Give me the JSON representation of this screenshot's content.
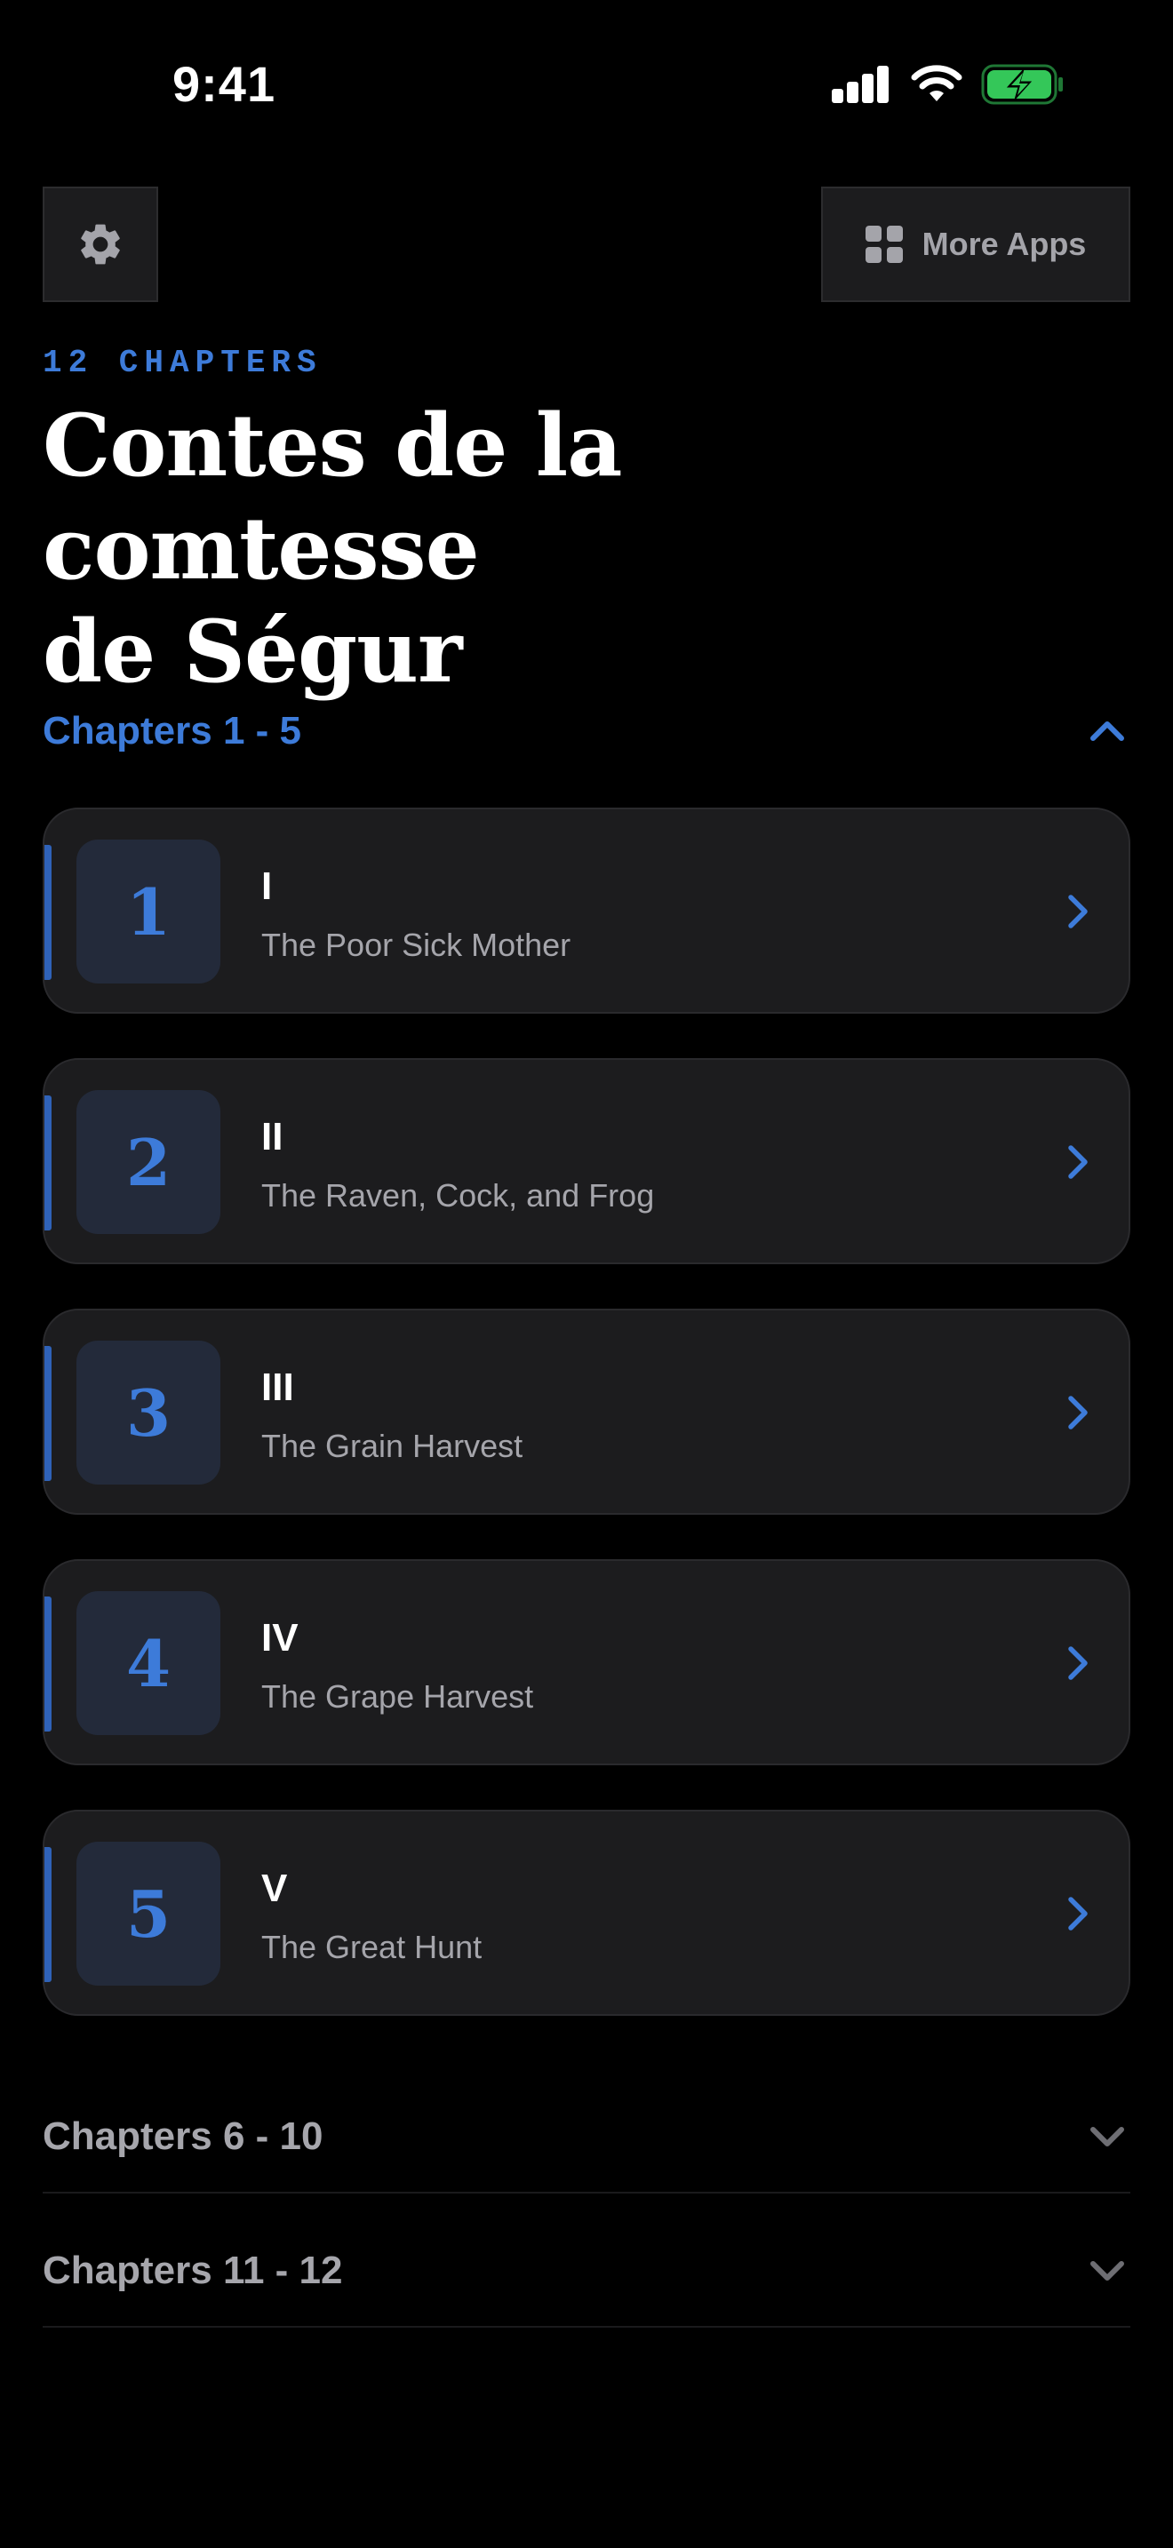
{
  "status_bar": {
    "time": "9:41",
    "signal_icon": "cellular-signal-icon",
    "wifi_icon": "wifi-icon",
    "battery_icon": "battery-charging-icon",
    "battery_color": "#34c759"
  },
  "toolbar": {
    "settings_icon": "gear-icon",
    "more_apps_icon": "grid-icon",
    "more_apps_label": "More Apps"
  },
  "header": {
    "chapter_count": "12 CHAPTERS",
    "title_line1": "Contes de la comtesse",
    "title_line2": "de Ségur"
  },
  "colors": {
    "accent": "#3d7bd9",
    "background": "#000000",
    "card": "#1c1c1e"
  },
  "sections": [
    {
      "label": "Chapters 1 - 5",
      "expanded": true,
      "icon": "chevron-up-icon",
      "chapters": [
        {
          "number": "1",
          "roman": "I",
          "title": "The Poor Sick Mother"
        },
        {
          "number": "2",
          "roman": "II",
          "title": "The Raven, Cock, and Frog"
        },
        {
          "number": "3",
          "roman": "III",
          "title": "The Grain Harvest"
        },
        {
          "number": "4",
          "roman": "IV",
          "title": "The Grape Harvest"
        },
        {
          "number": "5",
          "roman": "V",
          "title": "The Great Hunt"
        }
      ]
    },
    {
      "label": "Chapters 6 - 10",
      "expanded": false,
      "icon": "chevron-down-icon"
    },
    {
      "label": "Chapters 11 - 12",
      "expanded": false,
      "icon": "chevron-down-icon"
    }
  ]
}
